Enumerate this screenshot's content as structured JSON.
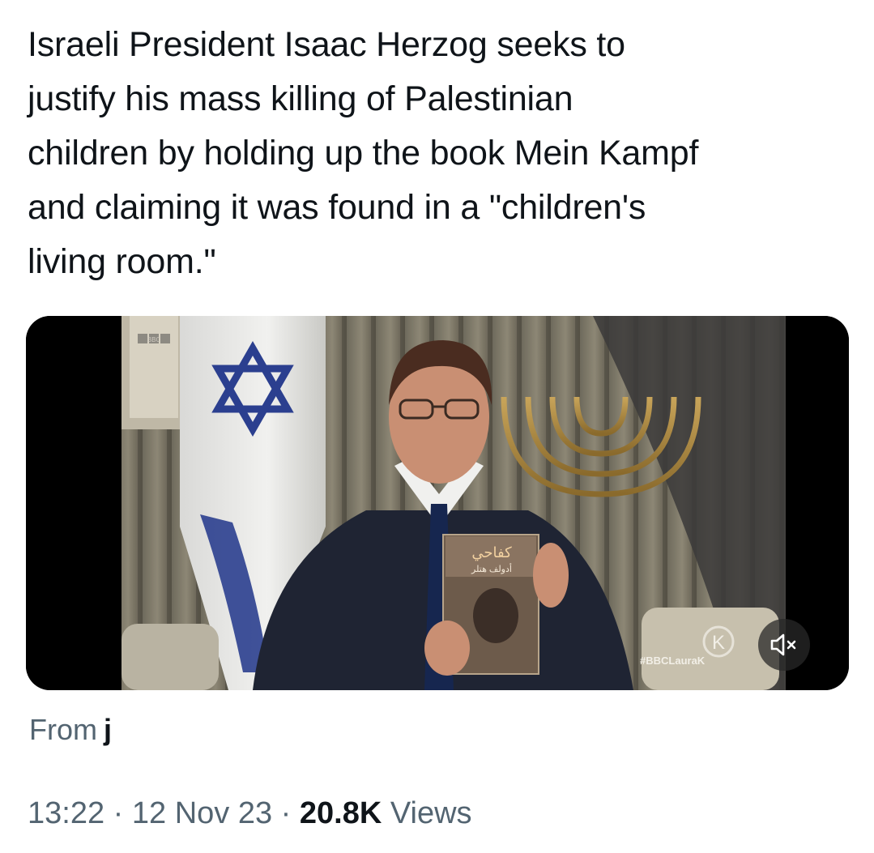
{
  "tweet": {
    "text": "Israeli President Isaac Herzog seeks to\njustify his mass killing of Palestinian\nchildren by holding up the book Mein Kampf\nand claiming it was found in a \"children's\nliving room.\""
  },
  "media": {
    "channel_logo_text": "BBC",
    "hashtag": "#BBCLauraK",
    "show_logo_letter": "K",
    "book_title_arabic": "كفاحي",
    "book_author_arabic": "أدولف هتلر",
    "mute_icon": "speaker-muted-icon"
  },
  "source": {
    "label": "From",
    "name": "j"
  },
  "meta": {
    "time": "13:22",
    "separator": "·",
    "date": "12 Nov 23",
    "views_count": "20.8K",
    "views_label": "Views"
  },
  "colors": {
    "text_primary": "#0f1419",
    "text_secondary": "#536471",
    "media_background": "#000000"
  }
}
